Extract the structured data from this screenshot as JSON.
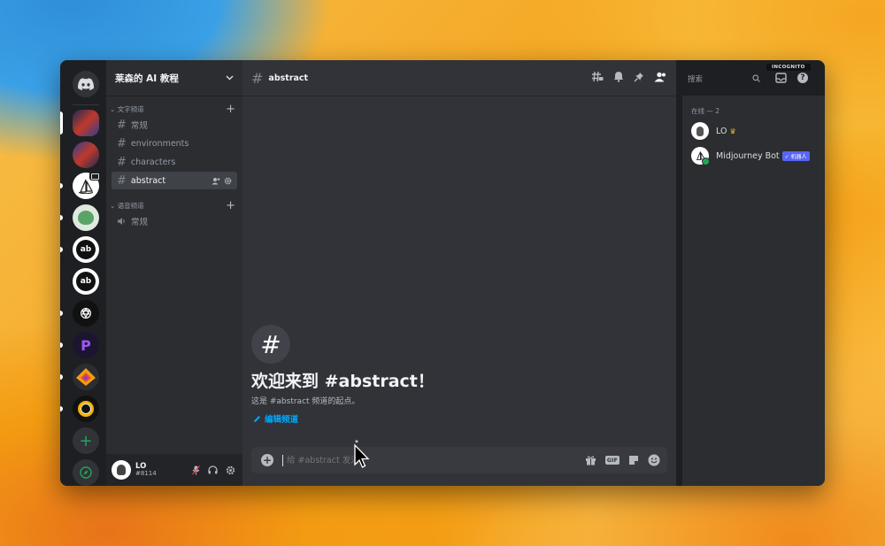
{
  "guild": {
    "name": "莱森的 AI 教程"
  },
  "categories": {
    "text": {
      "label": "文字频道"
    },
    "voice": {
      "label": "语音频道"
    }
  },
  "text_channels": [
    "常规",
    "environments",
    "characters",
    "abstract"
  ],
  "voice_channels": [
    "常规"
  ],
  "header": {
    "channel": "abstract",
    "search_placeholder": "搜索",
    "incognito": "INCOGNITO"
  },
  "welcome": {
    "title": "欢迎来到 #abstract！",
    "subtitle": "这是 #abstract 频道的起点。",
    "edit": "编辑频道"
  },
  "composer": {
    "placeholder": "给 #abstract 发消"
  },
  "user": {
    "name": "LO",
    "tag": "#8114"
  },
  "members": {
    "heading": "在线 — 2",
    "list": [
      {
        "name": "LO",
        "badge": ""
      },
      {
        "name": "Midjourney Bot",
        "badge": "✓ 机器人"
      }
    ]
  },
  "colors": {
    "accent": "#5865f2",
    "link": "#00a8fc",
    "online": "#23a55a"
  }
}
